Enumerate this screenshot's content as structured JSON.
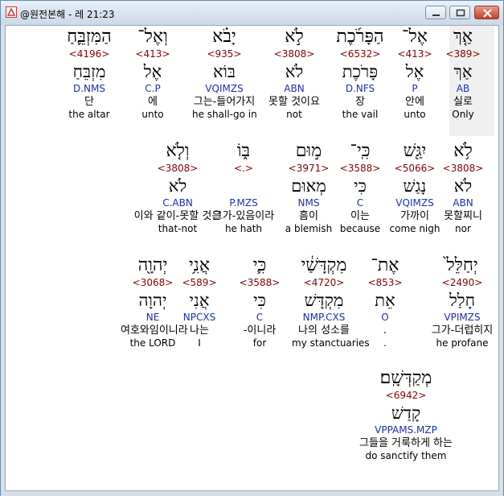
{
  "window": {
    "title": "@원전본해 - 레 21:23"
  },
  "words": [
    {
      "heb": "אַ֤ךְ",
      "strong": "<389>",
      "root": "אַךְ",
      "parse": "AB",
      "kor": "실로",
      "eng": "Only"
    },
    {
      "heb": "אֶל־",
      "strong": "<413>",
      "root": "אֶל",
      "parse": "P",
      "kor": "안에",
      "eng": "unto"
    },
    {
      "heb": "הַפָּרֹ֜כֶת",
      "strong": "<6532>",
      "root": "פָּרֹכֶת",
      "parse": "D.NFS",
      "kor": "장",
      "eng": "the vail"
    },
    {
      "heb": "לֹ֣א",
      "strong": "<3808>",
      "root": "לֹא",
      "parse": "ABN",
      "kor": "못할 것이요",
      "eng": "not"
    },
    {
      "heb": "יָבֹ֗א",
      "strong": "<935>",
      "root": "בּוֹא",
      "parse": "VQIMZS",
      "kor": "그는-들어가지",
      "eng": "he shall-go in"
    },
    {
      "heb": "וְאֶל־",
      "strong": "<413>",
      "root": "אֶל",
      "parse": "C.P",
      "kor": "에",
      "eng": "unto"
    },
    {
      "heb": "הַמִּזְבֵּ֛חַ",
      "strong": "<4196>",
      "root": "מִזְבֵּחַ",
      "parse": "D.NMS",
      "kor": "단",
      "eng": "the altar"
    },
    {
      "heb": "לֹ֥א",
      "strong": "<3808>",
      "root": "לֹא",
      "parse": "ABN",
      "kor": "못할찌니",
      "eng": "nor"
    },
    {
      "heb": "יִגַּ֖שׁ",
      "strong": "<5066>",
      "root": "נָגַשׁ",
      "parse": "VQIMZS",
      "kor": "가까이",
      "eng": "come nigh"
    },
    {
      "heb": "כִּֽי־",
      "strong": "<3588>",
      "root": "כִּי",
      "parse": "C",
      "kor": "이는",
      "eng": "because"
    },
    {
      "heb": "מ֣וּם",
      "strong": "<3971>",
      "root": "מְאוּם",
      "parse": "NMS",
      "kor": "흠이",
      "eng": "a blemish"
    },
    {
      "heb": "בּ֑וֹ",
      "strong": "<.>",
      "root": "",
      "parse": "P.MZS",
      "kor": "그가-있음이라",
      "eng": "he hath"
    },
    {
      "heb": "וְלֹ֤א",
      "strong": "<3808>",
      "root": "לֹא",
      "parse": "C.ABN",
      "kor": "이와 같이-못할 것은",
      "eng": "that-not"
    },
    {
      "heb": "יְחַלֵּל֙",
      "strong": "<2490>",
      "root": "חָלַל",
      "parse": "VPIMZS",
      "kor": "그가-더럽히지",
      "eng": "he profane"
    },
    {
      "heb": "אֶת־",
      "strong": "<853>",
      "root": "אֵת",
      "parse": "O",
      "kor": ".",
      "eng": "."
    },
    {
      "heb": "מִקְדָּשַׁ֔י",
      "strong": "<4720>",
      "root": "מִקְדָּשׁ",
      "parse": "NMP.CXS",
      "kor": "나의 성소를",
      "eng": "my stanctuaries"
    },
    {
      "heb": "כִּ֛י",
      "strong": "<3588>",
      "root": "כִּי",
      "parse": "C",
      "kor": "-이니라",
      "eng": "for"
    },
    {
      "heb": "אֲנִ֥י",
      "strong": "<589>",
      "root": "אֲנִי",
      "parse": "NPCXS",
      "kor": "나는",
      "eng": "I"
    },
    {
      "heb": "יְהוָ֖ה",
      "strong": "<3068>",
      "root": "יְהוָה",
      "parse": "NE",
      "kor": "여호와임이니라",
      "eng": "the LORD"
    },
    {
      "heb": "מְקַדְּשָֽׁם׃",
      "strong": "<6942>",
      "root": "קָדַשׁ",
      "parse": "VPPAMS.MZP",
      "kor": "그들을 거룩하게 하는",
      "eng": "do sanctify them"
    }
  ]
}
